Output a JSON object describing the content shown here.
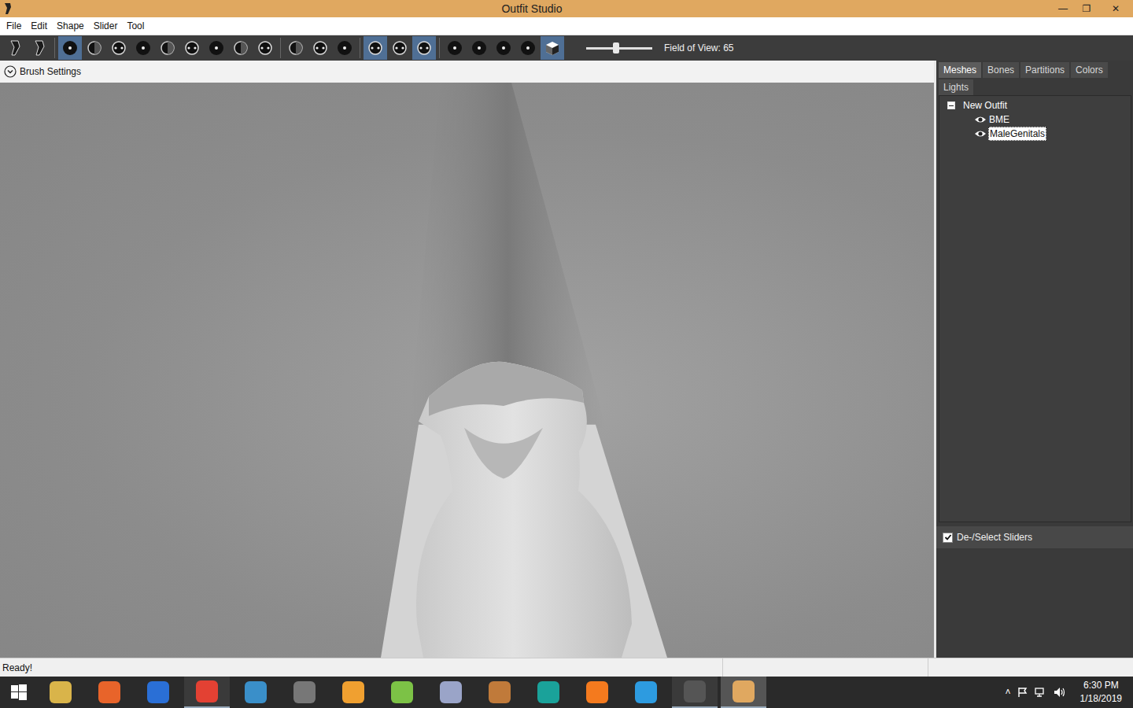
{
  "window": {
    "title": "Outfit Studio",
    "controls": [
      "—",
      "❐",
      "✕"
    ]
  },
  "menu": [
    "File",
    "Edit",
    "Shape",
    "Slider",
    "Tool"
  ],
  "toolbar": {
    "groups": [
      [
        {
          "selected": false
        },
        {
          "selected": false
        }
      ],
      [
        {
          "selected": true
        },
        {
          "selected": false
        },
        {
          "selected": false
        },
        {
          "selected": false
        },
        {
          "selected": false
        },
        {
          "selected": false
        },
        {
          "selected": false
        },
        {
          "selected": false
        },
        {
          "selected": false
        }
      ],
      [
        {
          "selected": false
        },
        {
          "selected": false
        },
        {
          "selected": false
        }
      ],
      [
        {
          "selected": true
        },
        {
          "selected": false
        },
        {
          "selected": true
        }
      ],
      [
        {
          "selected": false
        },
        {
          "selected": false
        },
        {
          "selected": false
        },
        {
          "selected": false
        },
        {
          "selected": true
        }
      ]
    ],
    "fov_slider": {
      "level": 0.45
    },
    "fov_label": "Field of View: 65"
  },
  "brush_settings": {
    "label": "Brush Settings",
    "expanded": false
  },
  "panel_tabs": [
    {
      "label": "Meshes",
      "selected": true
    },
    {
      "label": "Bones",
      "selected": false
    },
    {
      "label": "Partitions",
      "selected": false
    },
    {
      "label": "Colors",
      "selected": false
    },
    {
      "label": "Lights",
      "selected": false
    }
  ],
  "tree": {
    "root": {
      "label": "New Outfit",
      "expanded": true
    },
    "children": [
      {
        "label": "BME",
        "visible": true,
        "selected": false
      },
      {
        "label": "MaleGenitals",
        "visible": true,
        "selected": true
      }
    ]
  },
  "sliders_panel": {
    "label": "De-/Select Sliders",
    "checked": true
  },
  "status_bar": {
    "text": "Ready!"
  },
  "taskbar": {
    "apps": [
      {
        "open": false,
        "active": false,
        "color": "#d9b44a"
      },
      {
        "open": false,
        "active": false,
        "color": "#e8642a"
      },
      {
        "open": false,
        "active": false,
        "color": "#2a6fd6"
      },
      {
        "open": true,
        "active": false,
        "color": "#e34133"
      },
      {
        "open": false,
        "active": false,
        "color": "#3a8fc9"
      },
      {
        "open": false,
        "active": false,
        "color": "#777777"
      },
      {
        "open": false,
        "active": false,
        "color": "#f0a030"
      },
      {
        "open": false,
        "active": false,
        "color": "#7cc246"
      },
      {
        "open": false,
        "active": false,
        "color": "#9aa4c8"
      },
      {
        "open": false,
        "active": false,
        "color": "#c07a3a"
      },
      {
        "open": false,
        "active": false,
        "color": "#1aa29a"
      },
      {
        "open": false,
        "active": false,
        "color": "#f47a1e"
      },
      {
        "open": false,
        "active": false,
        "color": "#2d9be0"
      },
      {
        "open": true,
        "active": false,
        "color": "#555555"
      },
      {
        "open": true,
        "active": true,
        "color": "#e0a860"
      }
    ],
    "tray_arrow": "˄",
    "time": "6:30 PM",
    "date": "1/18/2019"
  }
}
